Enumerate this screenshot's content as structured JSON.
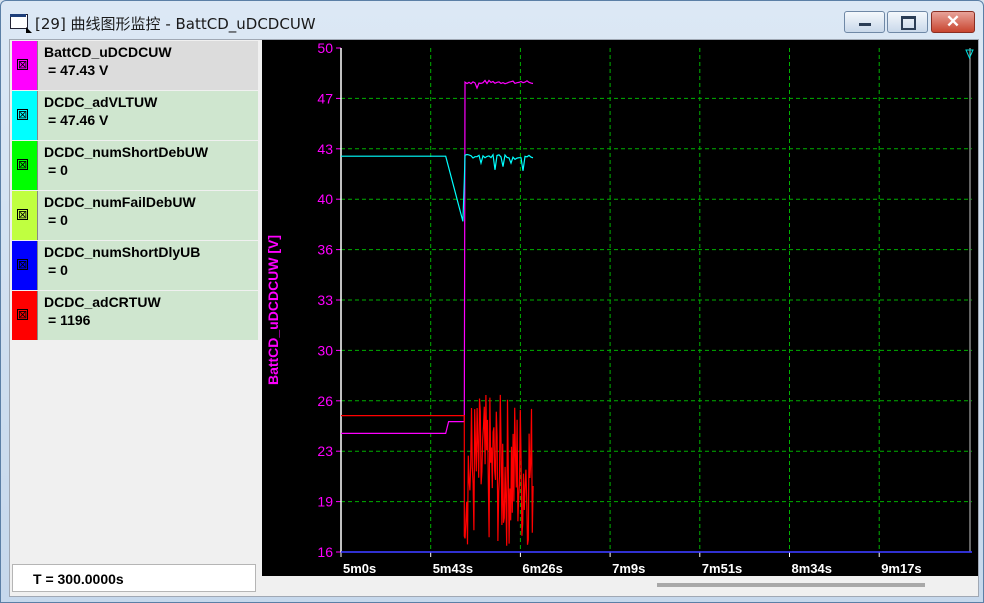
{
  "window": {
    "title": "[29] 曲线图形监控 - BattCD_uDCDCUW"
  },
  "signals": [
    {
      "name": "BattCD_uDCDCUW",
      "value": " = 47.43 V",
      "color": "#ff00ff",
      "checked": true,
      "bg": "#dcdcdc"
    },
    {
      "name": "DCDC_adVLTUW",
      "value": " = 47.46 V",
      "color": "#00ffff",
      "checked": true,
      "bg": "#cfe6cf"
    },
    {
      "name": "DCDC_numShortDebUW",
      "value": " = 0",
      "color": "#00ff00",
      "checked": true,
      "bg": "#cfe6cf"
    },
    {
      "name": "DCDC_numFailDebUW",
      "value": " = 0",
      "color": "#c0ff40",
      "checked": true,
      "bg": "#cfe6cf"
    },
    {
      "name": "DCDC_numShortDlyUB",
      "value": " = 0",
      "color": "#0000ff",
      "checked": true,
      "bg": "#cfe6cf"
    },
    {
      "name": "DCDC_adCRTUW",
      "value": " = 1196",
      "color": "#ff0000",
      "checked": true,
      "bg": "#cfe6cf"
    }
  ],
  "checkbox_glyph": "⊠",
  "time_readout": "T = 300.0000s",
  "chart_data": {
    "type": "line",
    "ylabel": "BattCD_uDCDCUW [V]",
    "ylabel_color": "#ff00ff",
    "y_ticks": [
      "50",
      "47",
      "43",
      "40",
      "36",
      "33",
      "30",
      "26",
      "23",
      "19",
      "16"
    ],
    "ylim": [
      16,
      50
    ],
    "x_ticks": [
      "5m0s",
      "5m43s",
      "6m26s",
      "7m9s",
      "7m51s",
      "8m34s",
      "9m17s"
    ],
    "xlim_s": [
      300,
      740
    ],
    "grid": true,
    "grid_color": "#00b000",
    "background": "#000000",
    "series": [
      {
        "name": "BattCD_uDCDCUW",
        "color": "#ff00ff",
        "points": [
          [
            300,
            24.0
          ],
          [
            373,
            24.0
          ],
          [
            375,
            24.8
          ],
          [
            386,
            24.8
          ],
          [
            386.5,
            47.7
          ],
          [
            434,
            47.7
          ]
        ],
        "noise": {
          "from": 386.5,
          "to": 434,
          "base": 47.7,
          "dips_to": 46.9
        }
      },
      {
        "name": "DCDC_adVLTUW",
        "color": "#00ffff",
        "points": [
          [
            300,
            42.7
          ],
          [
            373,
            42.7
          ],
          [
            385,
            38.3
          ],
          [
            386,
            41.0
          ],
          [
            386.5,
            42.7
          ],
          [
            434,
            42.7
          ]
        ],
        "noise": {
          "from": 386.5,
          "to": 434,
          "base": 42.7,
          "dips_to": 41.4
        }
      },
      {
        "name": "DCDC_adCRTUW",
        "color": "#ff0000",
        "points": [
          [
            300,
            25.2
          ],
          [
            386,
            25.2
          ],
          [
            434,
            24.0
          ]
        ],
        "noise": {
          "from": 386,
          "to": 434,
          "min": 16.2,
          "max": 26.7
        }
      },
      {
        "name": "DCDC_numShortDlyUB",
        "color": "#0000ff",
        "points": [
          [
            300,
            16.0
          ],
          [
            740,
            16.0
          ]
        ]
      }
    ]
  }
}
